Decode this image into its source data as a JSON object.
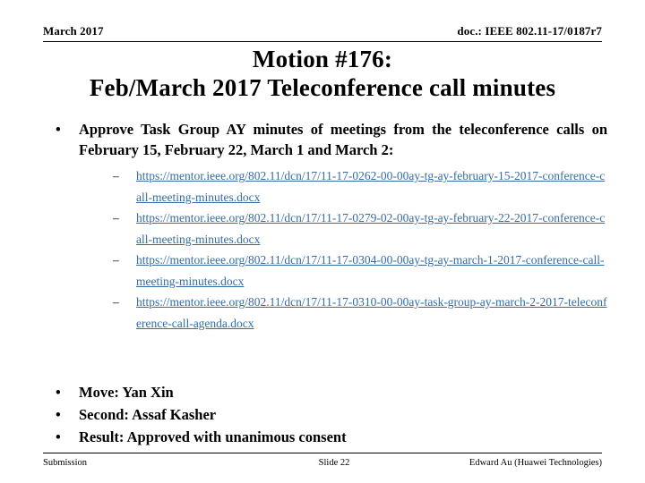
{
  "header": {
    "left": "March 2017",
    "right": "doc.: IEEE 802.11-17/0187r7"
  },
  "title": {
    "line1": "Motion #176:",
    "line2": "Feb/March 2017 Teleconference call minutes"
  },
  "content": {
    "bullet_marker": "•",
    "subbullet_marker": "–",
    "main_bullet": "Approve Task Group AY minutes of meetings from the teleconference calls on February 15, February 22, March 1 and March 2:",
    "links": [
      "https://mentor.ieee.org/802.11/dcn/17/11-17-0262-00-00ay-tg-ay-february-15-2017-conference-call-meeting-minutes.docx",
      "https://mentor.ieee.org/802.11/dcn/17/11-17-0279-02-00ay-tg-ay-february-22-2017-conference-call-meeting-minutes.docx",
      "https://mentor.ieee.org/802.11/dcn/17/11-17-0304-00-00ay-tg-ay-march-1-2017-conference-call-meeting-minutes.docx",
      "https://mentor.ieee.org/802.11/dcn/17/11-17-0310-00-00ay-task-group-ay-march-2-2017-teleconference-call-agenda.docx"
    ],
    "motion_lines": [
      "Move:  Yan Xin",
      "Second:  Assaf Kasher",
      "Result:  Approved with unanimous consent"
    ]
  },
  "footer": {
    "left": "Submission",
    "center": "Slide 22",
    "right": "Edward Au (Huawei Technologies)"
  },
  "colors": {
    "link": "#356ca5",
    "text": "#000000",
    "background": "#ffffff"
  }
}
